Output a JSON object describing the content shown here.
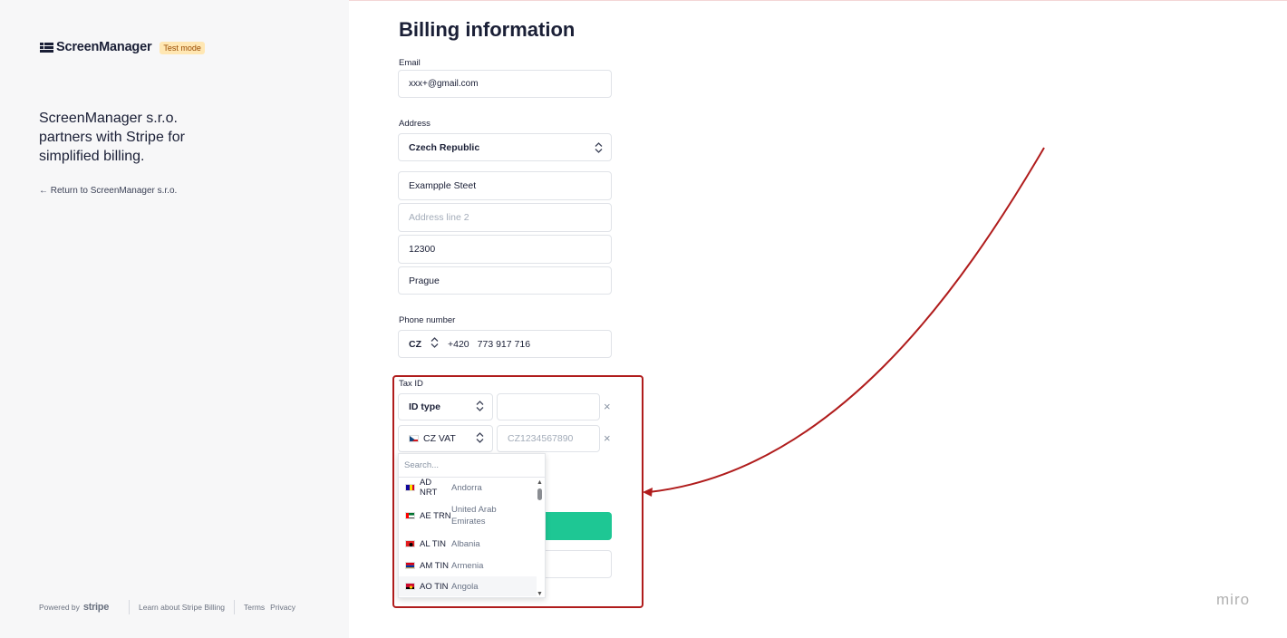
{
  "brand": {
    "name": "ScreenManager",
    "badge": "Test mode"
  },
  "left": {
    "tagline": "ScreenManager s.r.o. partners with Stripe for simplified billing.",
    "return_link": "← Return to ScreenManager s.r.o.",
    "footer": {
      "powered_by": "Powered by",
      "stripe": "stripe",
      "learn": "Learn about Stripe Billing",
      "terms": "Terms",
      "privacy": "Privacy"
    }
  },
  "form": {
    "title": "Billing information",
    "email": {
      "label": "Email",
      "value": "xxx+@gmail.com"
    },
    "address": {
      "label": "Address",
      "country": "Czech Republic",
      "line1": "Exampple Steet",
      "line2_placeholder": "Address line 2",
      "postal": "12300",
      "city": "Prague"
    },
    "phone": {
      "label": "Phone number",
      "country": "CZ",
      "prefix": "+420",
      "number": "773 917 716"
    },
    "tax": {
      "label": "Tax ID",
      "row1": {
        "type": "ID type",
        "value": ""
      },
      "row2": {
        "type": "CZ VAT",
        "placeholder": "CZ1234567890"
      },
      "remove": "×"
    }
  },
  "dropdown": {
    "search_placeholder": "Search...",
    "items": [
      {
        "code": "AD NRT",
        "country": "Andorra"
      },
      {
        "code": "AE TRN",
        "country": "United Arab Emirates"
      },
      {
        "code": "AL TIN",
        "country": "Albania"
      },
      {
        "code": "AM TIN",
        "country": "Armenia"
      },
      {
        "code": "AO TIN",
        "country": "Angola"
      }
    ]
  },
  "watermark": "miro",
  "colors": {
    "accent_green": "#1ec794",
    "annotation_red": "#b01c1c",
    "badge_bg": "#ffe7b3"
  }
}
